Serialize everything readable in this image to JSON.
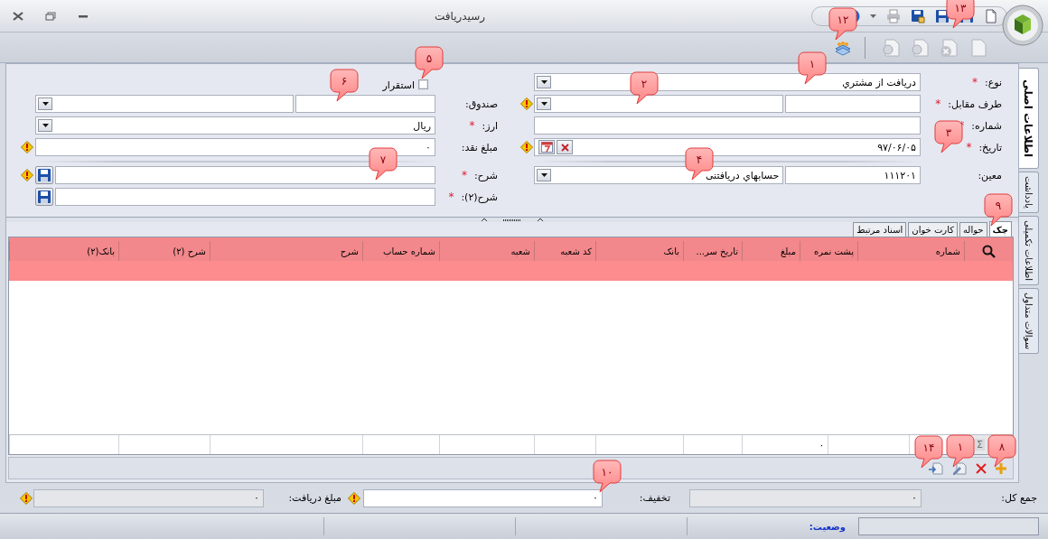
{
  "window": {
    "title": "رسیدریافت"
  },
  "form": {
    "main_fields": [
      {
        "kind": "combo",
        "label": "نوع:",
        "mark": "*",
        "value": "دریافت از مشتري",
        "warning": false
      },
      {
        "kind": "code-combo",
        "label": "طرف مقابل:",
        "mark": "*",
        "warning": true
      },
      {
        "kind": "text",
        "label": "شماره:",
        "mark": "*",
        "warning": false
      },
      {
        "kind": "date",
        "label": "تاریخ:",
        "mark": "*",
        "value": "۹۷/۰۶/۰۵",
        "warning": true
      },
      {
        "kind": "code-combo",
        "label": "معین:",
        "code": "۱۱۱۲۰۱",
        "value": "حسابهاي دریافتنی",
        "warning": false
      }
    ],
    "checkbox": {
      "label": "استقرار",
      "checked": false
    },
    "side_fields": [
      {
        "kind": "code-combo",
        "label": "صندوق:",
        "warning": false
      },
      {
        "kind": "combo",
        "label": "ارز:",
        "mark": "*",
        "value": "ریال",
        "warning": false
      },
      {
        "kind": "text",
        "label": "مبلغ نقد:",
        "value": "۰",
        "warning": true
      },
      {
        "kind": "memo",
        "label": "شرح:",
        "mark": "*",
        "warning": true
      },
      {
        "kind": "memo",
        "label": "شرح(۲):",
        "mark": "*",
        "warning": false
      }
    ]
  },
  "side_tabs": [
    {
      "label": "اطلاعات اصلی",
      "selected": true
    },
    {
      "label": "یادداشت",
      "selected": false
    },
    {
      "label": "اطلاعات تکمیلی",
      "selected": false
    },
    {
      "label": "سوالات متداول",
      "selected": false
    }
  ],
  "grid": {
    "tabs": [
      {
        "label": "چک",
        "selected": true
      },
      {
        "label": "حواله",
        "selected": false
      },
      {
        "label": "کارت خوان",
        "selected": false
      },
      {
        "label": "اسناد مرتبط",
        "selected": false
      }
    ],
    "columns": [
      "شماره",
      "پشت نمره",
      "مبلغ",
      "تاریخ سر...",
      "بانک",
      "کد شعبه",
      "شعبه",
      "شماره حساب",
      "شرح",
      "شرح (۲)",
      "بانک(۲)"
    ],
    "sum_row": {
      "symbol": "Σ",
      "amount": "۰"
    }
  },
  "totals": [
    {
      "label": "جمع کل:",
      "value": "۰",
      "readonly": true,
      "warning": false
    },
    {
      "label": "تخفیف:",
      "value": "۰",
      "readonly": false,
      "warning": true
    },
    {
      "label": "مبلغ دریافت:",
      "value": "۰",
      "readonly": true,
      "warning": true
    }
  ],
  "status_bar": {
    "label": "وضعیت:"
  },
  "callouts": [
    "۱",
    "۲",
    "۳",
    "۴",
    "۵",
    "۶",
    "۷",
    "۸",
    "۹",
    "۱۰",
    "۱",
    "۱۲",
    "۱۳",
    "۱۴"
  ]
}
